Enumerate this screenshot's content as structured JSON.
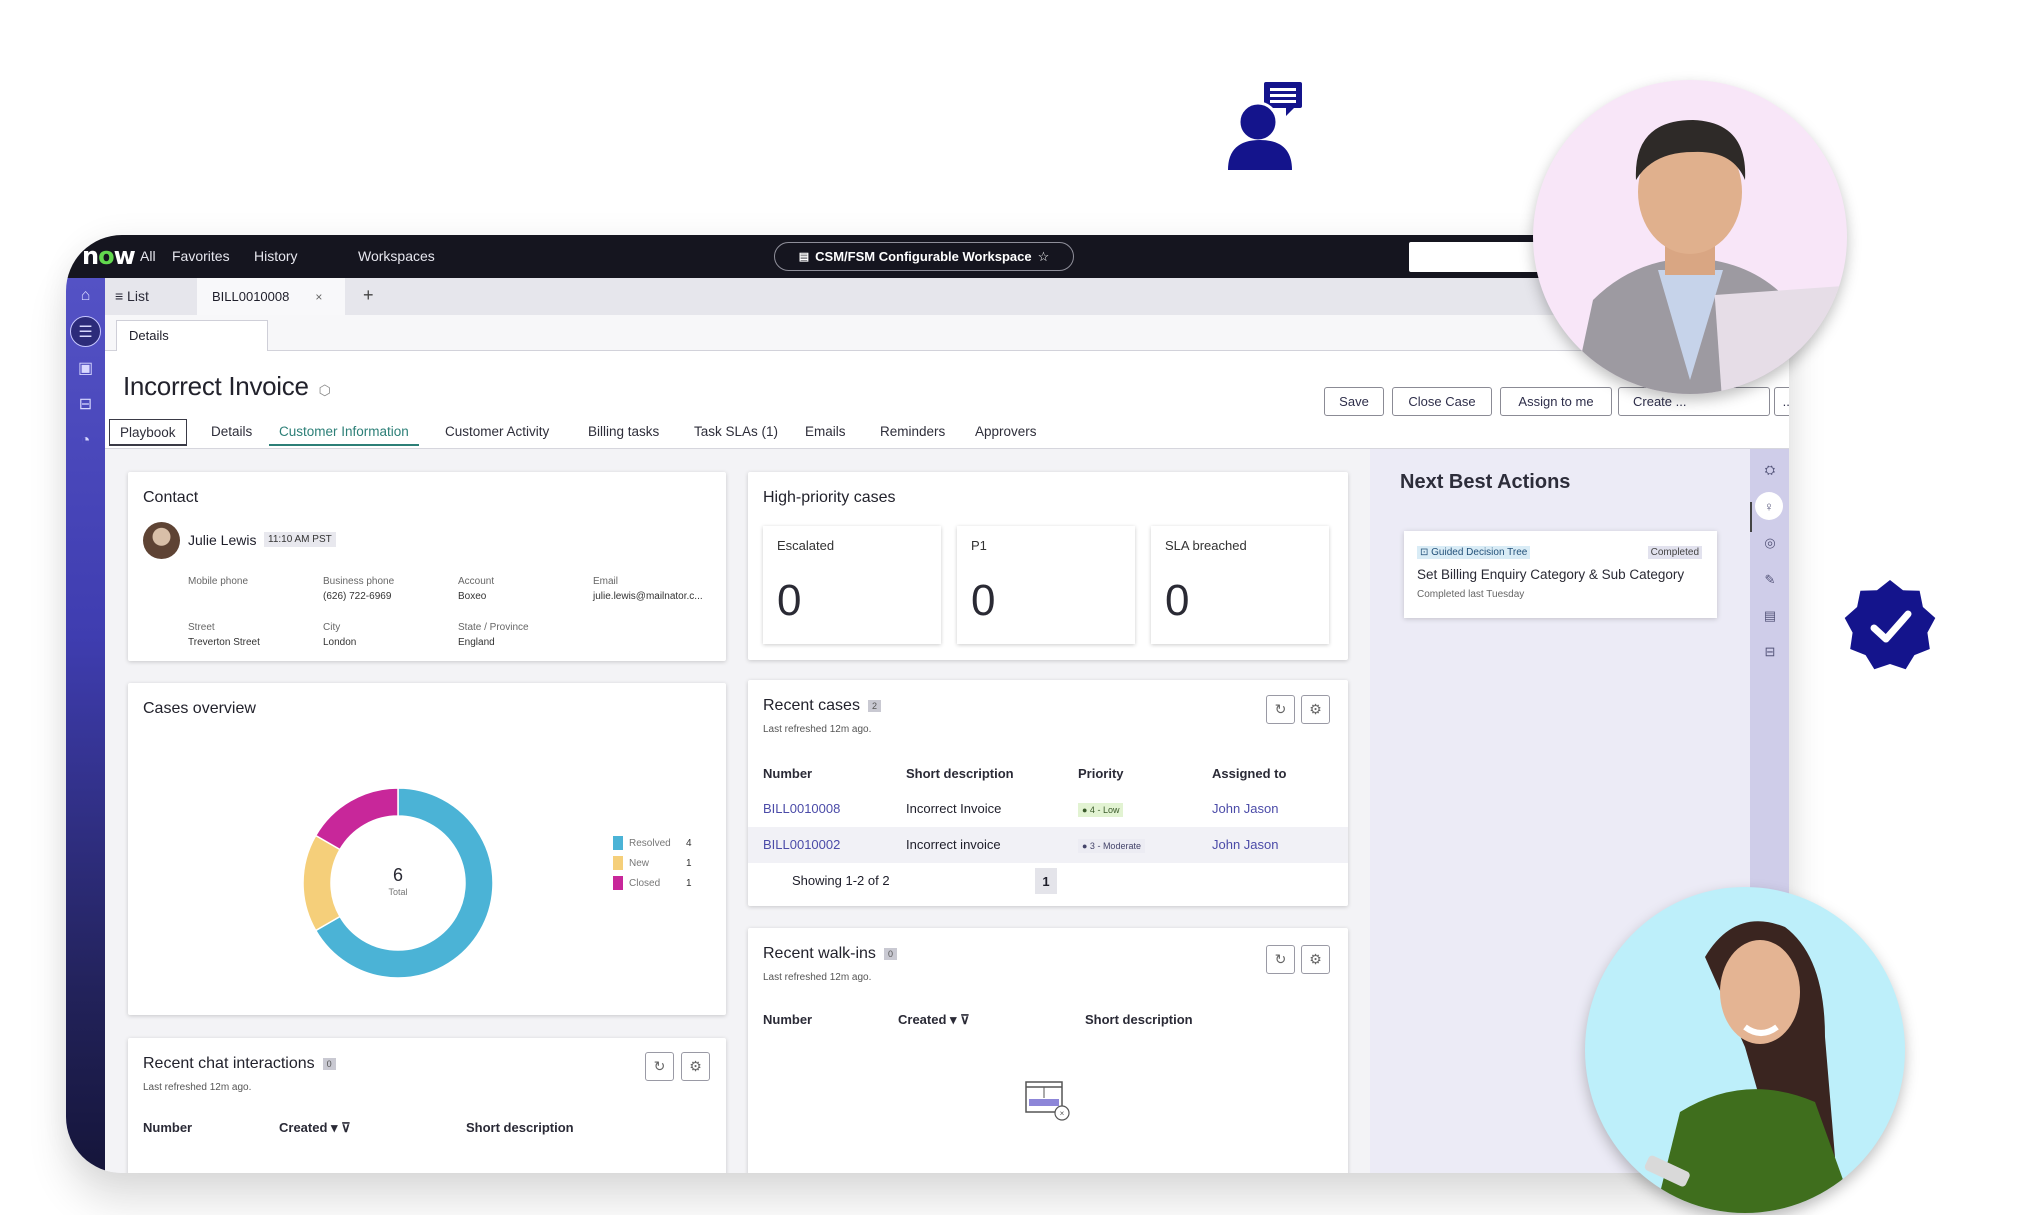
{
  "decorations": {
    "agent_icon": "agent-chat-icon",
    "verified_badge": "verified-badge-icon",
    "colors": {
      "navy": "#14148c",
      "accent": "#5452c5"
    }
  },
  "topnav": {
    "logo": {
      "n": "n",
      "o": "o",
      "w": "w"
    },
    "items": [
      "All",
      "Favorites",
      "History",
      "Workspaces"
    ],
    "workspace": "CSM/FSM Configurable Workspace",
    "search_placeholder": ""
  },
  "tabstrip": {
    "list_label": "≡ List",
    "record_tab": "BILL0010008",
    "close": "×",
    "add": "+"
  },
  "subtab": "Details",
  "record": {
    "title": "Incorrect Invoice",
    "buttons": [
      "Save",
      "Close Case",
      "Assign to me",
      "Create ...",
      "..."
    ],
    "tabs": [
      {
        "label": "Playbook",
        "state": "boxed"
      },
      {
        "label": "Details",
        "state": ""
      },
      {
        "label": "Customer Information",
        "state": "selected"
      },
      {
        "label": "Customer Activity",
        "state": ""
      },
      {
        "label": "Billing tasks",
        "state": ""
      },
      {
        "label": "Task SLAs (1)",
        "state": ""
      },
      {
        "label": "Emails",
        "state": ""
      },
      {
        "label": "Reminders",
        "state": ""
      },
      {
        "label": "Approvers",
        "state": ""
      }
    ]
  },
  "contact": {
    "title": "Contact",
    "name": "Julie Lewis",
    "local_time": "11:10 AM PST",
    "fields": [
      {
        "label": "Mobile phone",
        "value": ""
      },
      {
        "label": "Business phone",
        "value": "(626) 722-6969"
      },
      {
        "label": "Account",
        "value": "Boxeo"
      },
      {
        "label": "Email",
        "value": "julie.lewis@mailnator.c..."
      },
      {
        "label": "Street",
        "value": "Treverton Street"
      },
      {
        "label": "City",
        "value": "London"
      },
      {
        "label": "State / Province",
        "value": "England"
      }
    ]
  },
  "high_priority": {
    "title": "High-priority cases",
    "tiles": [
      {
        "label": "Escalated",
        "value": "0"
      },
      {
        "label": "P1",
        "value": "0"
      },
      {
        "label": "SLA breached",
        "value": "0"
      }
    ]
  },
  "cases_overview": {
    "title": "Cases overview",
    "center_value": "6",
    "center_label": "Total"
  },
  "chart_data": {
    "type": "pie",
    "title": "Cases overview",
    "categories": [
      "Resolved",
      "New",
      "Closed"
    ],
    "values": [
      4,
      1,
      1
    ],
    "colors": [
      "#4bb3d6",
      "#f5cf7a",
      "#c8279a"
    ],
    "total": 6,
    "legend": "right"
  },
  "recent_cases": {
    "title": "Recent cases",
    "count": "2",
    "refreshed": "Last refreshed 12m ago.",
    "columns": [
      "Number",
      "Short description",
      "Priority",
      "Assigned to"
    ],
    "rows": [
      {
        "number": "BILL0010008",
        "description": "Incorrect Invoice",
        "priority": "● 4 - Low",
        "assigned": "John Jason"
      },
      {
        "number": "BILL0010002",
        "description": "Incorrect invoice",
        "priority": "● 3 - Moderate",
        "assigned": "John Jason"
      }
    ],
    "showing": "Showing 1-2 of 2",
    "page": "1"
  },
  "recent_walkins": {
    "title": "Recent walk-ins",
    "count": "0",
    "refreshed": "Last refreshed 12m ago.",
    "columns": [
      "Number",
      "Created ▾ ⊽",
      "Short description"
    ]
  },
  "recent_chats": {
    "title": "Recent chat interactions",
    "count": "0",
    "refreshed": "Last refreshed 12m ago.",
    "columns": [
      "Number",
      "Created ▾ ⊽",
      "Short description"
    ]
  },
  "nba": {
    "title": "Next Best Actions",
    "chip": "⊡ Guided Decision Tree",
    "status": "Completed",
    "action": "Set Billing Enquiry Category & Sub Category",
    "when": "Completed last Tuesday"
  },
  "icons": {
    "refresh": "↻",
    "settings": "⚙"
  }
}
